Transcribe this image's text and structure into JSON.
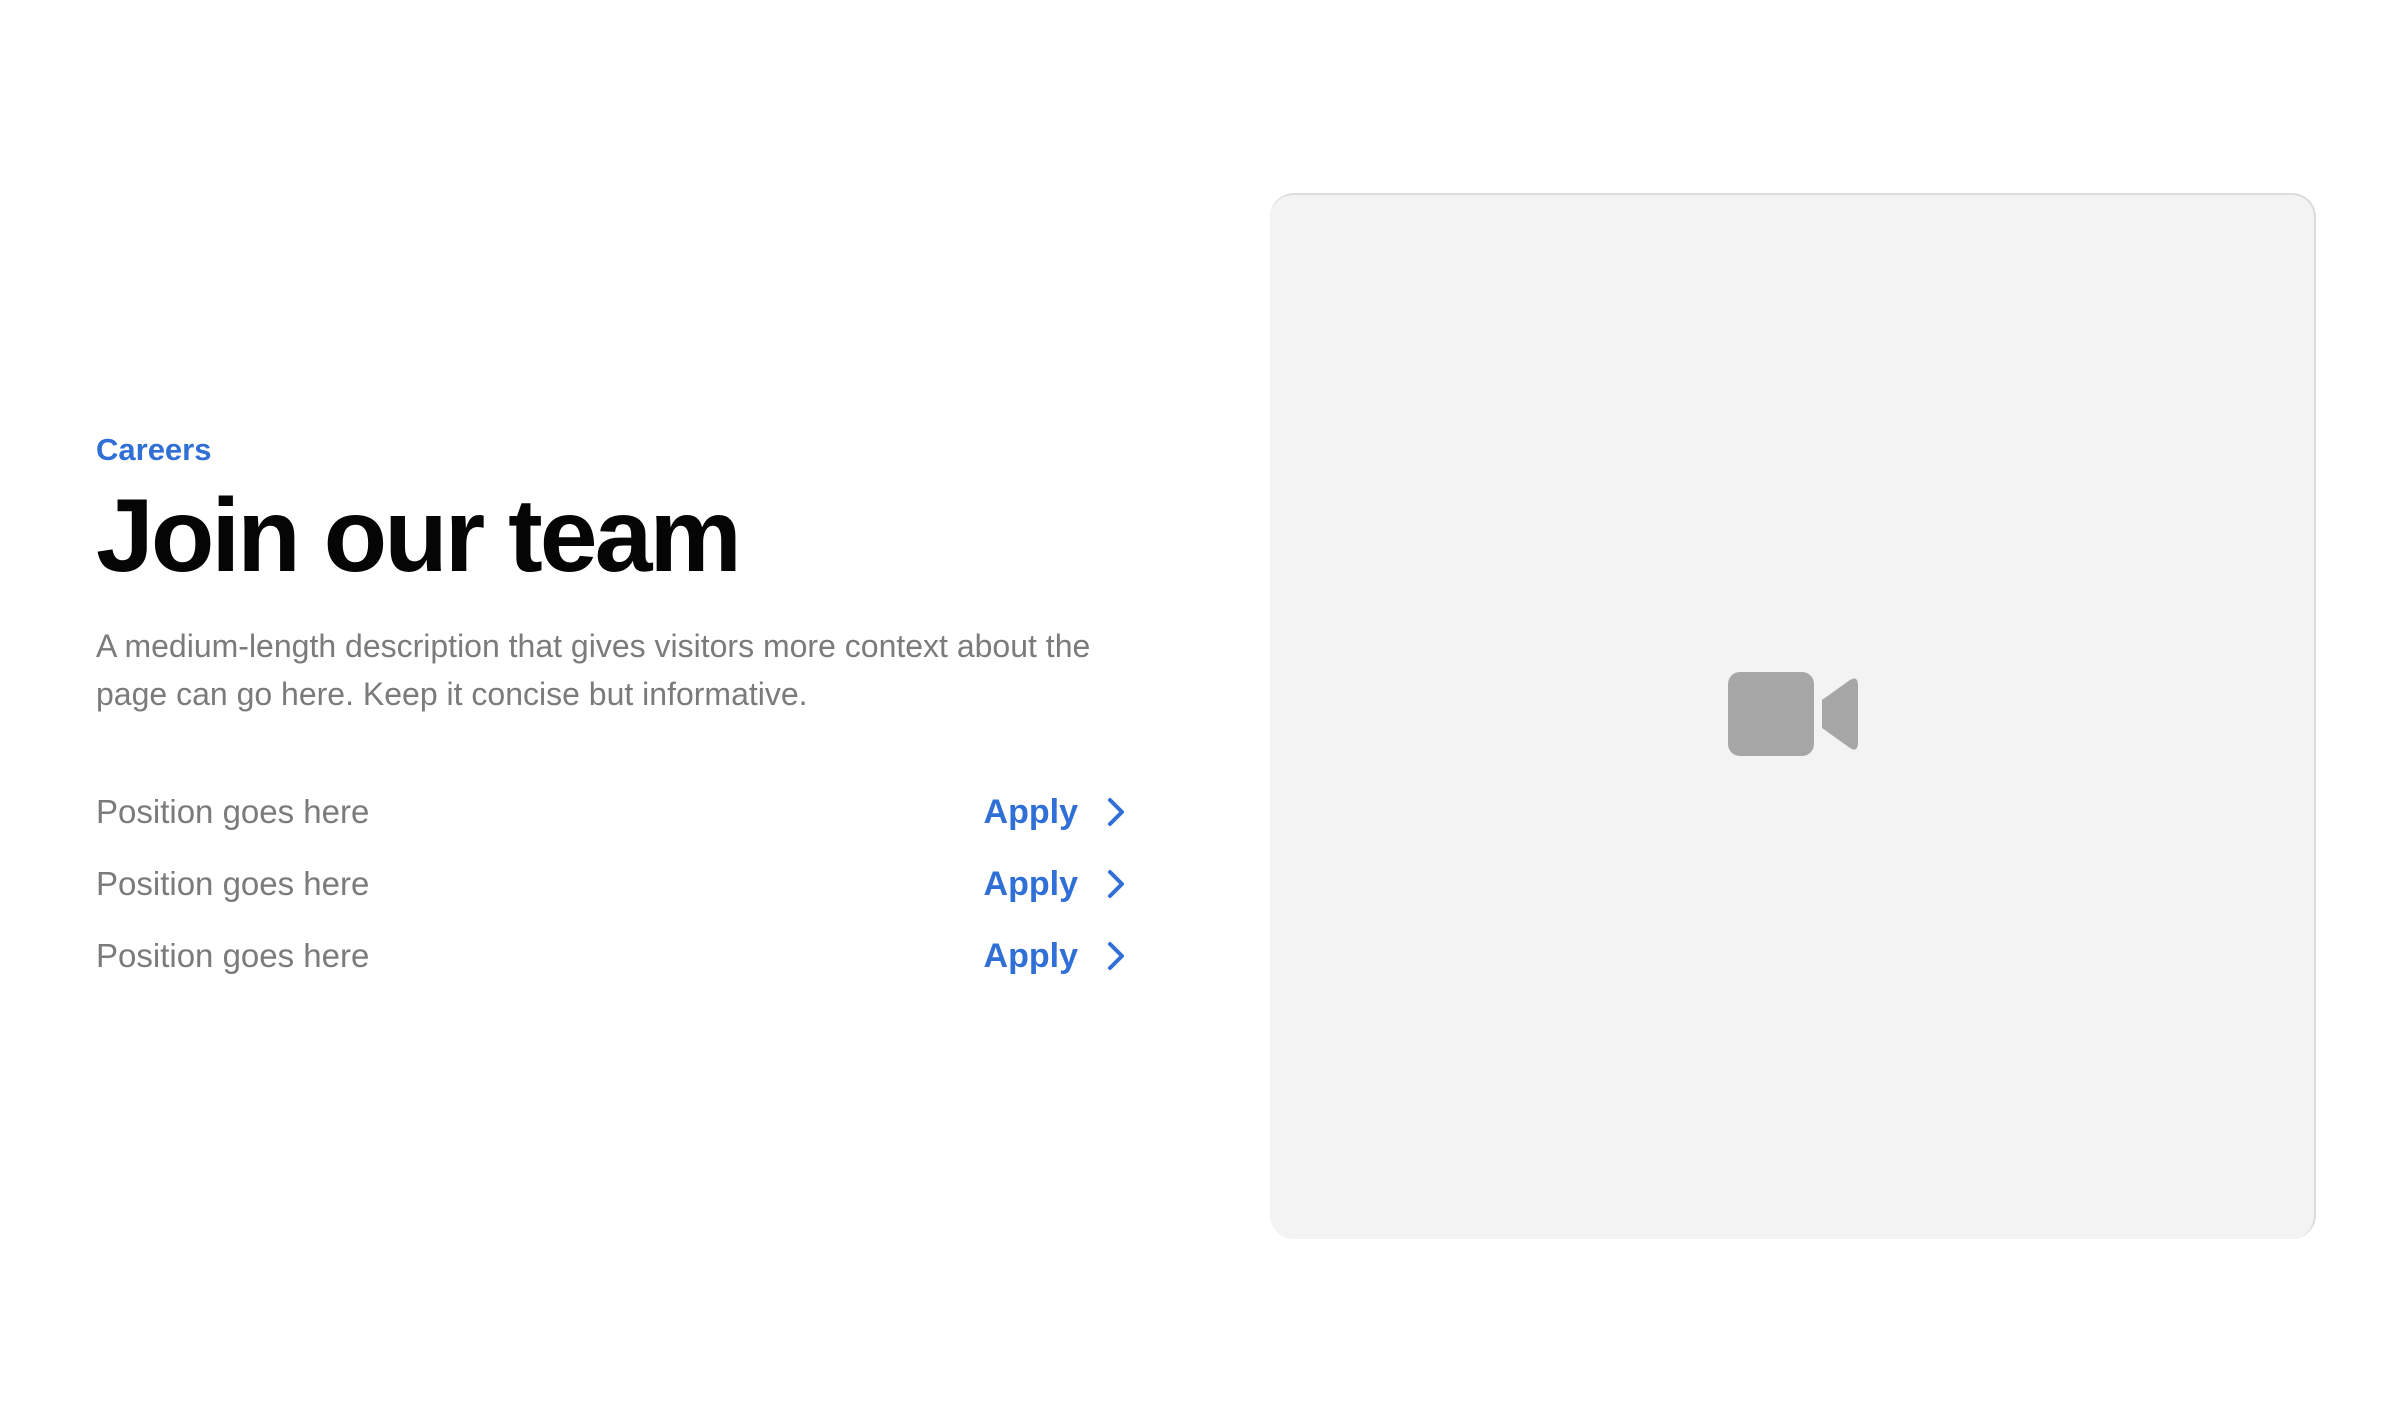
{
  "hero": {
    "eyebrow": "Careers",
    "title": "Join our team",
    "description": "A medium-length description that gives visitors more context about the page can go here. Keep it concise but informative."
  },
  "positions": [
    {
      "label": "Position goes here",
      "action": "Apply"
    },
    {
      "label": "Position goes here",
      "action": "Apply"
    },
    {
      "label": "Position goes here",
      "action": "Apply"
    }
  ],
  "media": {
    "icon": "video-camera-icon"
  },
  "colors": {
    "accent": "#2f6fd6",
    "heading": "#050505",
    "muted": "#7b7b7b",
    "media_background": "#f3f3f3",
    "icon": "#a6a6a6"
  }
}
